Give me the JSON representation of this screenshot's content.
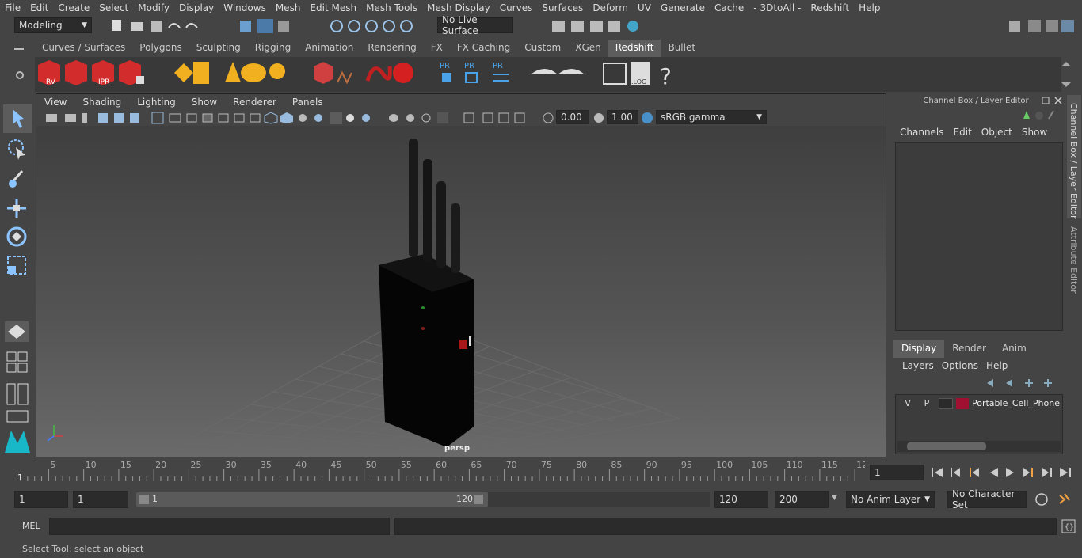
{
  "menu": [
    "File",
    "Edit",
    "Create",
    "Select",
    "Modify",
    "Display",
    "Windows",
    "Mesh",
    "Edit Mesh",
    "Mesh Tools",
    "Mesh Display",
    "Curves",
    "Surfaces",
    "Deform",
    "UV",
    "Generate",
    "Cache",
    "- 3DtoAll -",
    "Redshift",
    "Help"
  ],
  "status": {
    "mode": "Modeling",
    "live_surface": "No Live Surface"
  },
  "shelf_tabs": [
    "Curves / Surfaces",
    "Polygons",
    "Sculpting",
    "Rigging",
    "Animation",
    "Rendering",
    "FX",
    "FX Caching",
    "Custom",
    "XGen",
    "Redshift",
    "Bullet"
  ],
  "shelf_active": "Redshift",
  "shelf_icons": {
    "rv": "RV",
    "ipr": "IPR",
    "pr1": "PR",
    "pr2": "PR",
    "pr3": "PR",
    "log": ".LOG",
    "help": "?"
  },
  "panel_menu": [
    "View",
    "Shading",
    "Lighting",
    "Show",
    "Renderer",
    "Panels"
  ],
  "panel_toolbar": {
    "exposure": "0.00",
    "gamma": "1.00",
    "colorspace": "sRGB gamma"
  },
  "viewport": {
    "camera_label": "persp"
  },
  "channel_box": {
    "title": "Channel Box / Layer Editor",
    "menu": [
      "Channels",
      "Edit",
      "Object",
      "Show"
    ]
  },
  "layer_editor": {
    "tabs": [
      "Display",
      "Render",
      "Anim"
    ],
    "active_tab": "Display",
    "menu": [
      "Layers",
      "Options",
      "Help"
    ],
    "layer": {
      "v": "V",
      "p": "P",
      "name": "Portable_Cell_Phone_E",
      "color": "#a01030"
    }
  },
  "side_tabs": [
    "Channel Box / Layer Editor",
    "Attribute Editor"
  ],
  "timeline": {
    "ticks": [
      "5",
      "10",
      "15",
      "20",
      "25",
      "30",
      "35",
      "40",
      "45",
      "50",
      "55",
      "60",
      "65",
      "70",
      "75",
      "80",
      "85",
      "90",
      "95",
      "100",
      "105",
      "110",
      "115",
      "12"
    ],
    "start_label": "1",
    "current_frame": "1"
  },
  "range": {
    "start": "1",
    "start2": "1",
    "slider_start": "1",
    "slider_end": "120",
    "end": "120",
    "end2": "200",
    "anim_layer": "No Anim Layer",
    "char_set": "No Character Set"
  },
  "cmd": {
    "lang": "MEL"
  },
  "help_line": "Select Tool: select an object"
}
